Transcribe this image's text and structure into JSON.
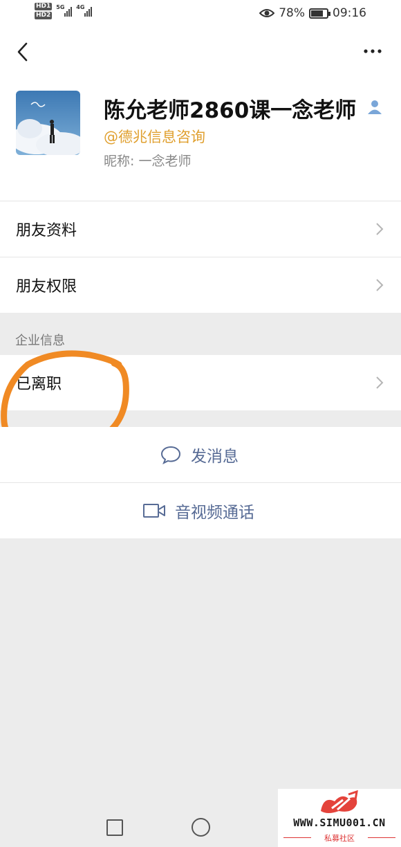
{
  "status_bar": {
    "hd1": "HD1",
    "hd2": "HD2",
    "network1": "5G",
    "network2": "4G",
    "battery_percent": "78%",
    "battery_level": 0.78,
    "time": "09:16"
  },
  "navbar": {
    "back_icon": "chevron-left-icon",
    "more_icon": "more-dots-icon"
  },
  "profile": {
    "name": "陈允老师2860课一念老师",
    "company": "@德兆信息咨询",
    "nickname": "昵称:  一念老师",
    "verified_icon": "person-icon"
  },
  "rows": {
    "friend_info": "朋友资料",
    "friend_permissions": "朋友权限"
  },
  "enterprise": {
    "section_title": "企业信息",
    "status": "已离职"
  },
  "actions": {
    "message": "发消息",
    "video_call": "音视频通话"
  },
  "watermark": {
    "url": "WWW.SIMU001.CN",
    "subtitle": "私募社区"
  },
  "colors": {
    "accent_link": "#576b95",
    "company": "#e0a030",
    "annotation": "#f08a24",
    "background": "#ececec"
  }
}
